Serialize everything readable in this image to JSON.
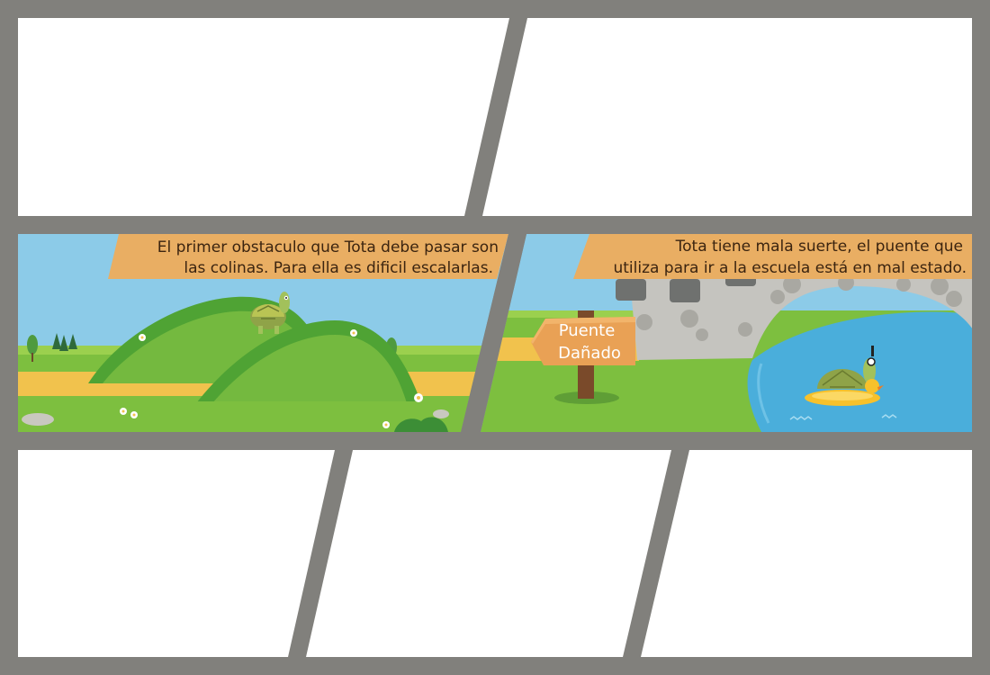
{
  "panel_left": {
    "caption_line_1": "El primer obstaculo que Tota debe pasar son",
    "caption_line_2": "las colinas. Para ella es dificil escalarlas."
  },
  "panel_right": {
    "caption_line_1": "Tota tiene mala suerte, el puente que",
    "caption_line_2": "utiliza para ir a la escuela está en mal estado.",
    "sign_line_1": "Puente",
    "sign_line_2": "Dañado"
  },
  "colors": {
    "gutter": "#81807c",
    "panel_blank": "#ffffff",
    "sky": "#8ccbe8",
    "grass": "#7dbf3f",
    "hill": "#5aa832",
    "path": "#f1c24d",
    "caption_banner": "#e9ae63",
    "water": "#4aaedb",
    "bridge_stone": "#c5c4bf"
  }
}
